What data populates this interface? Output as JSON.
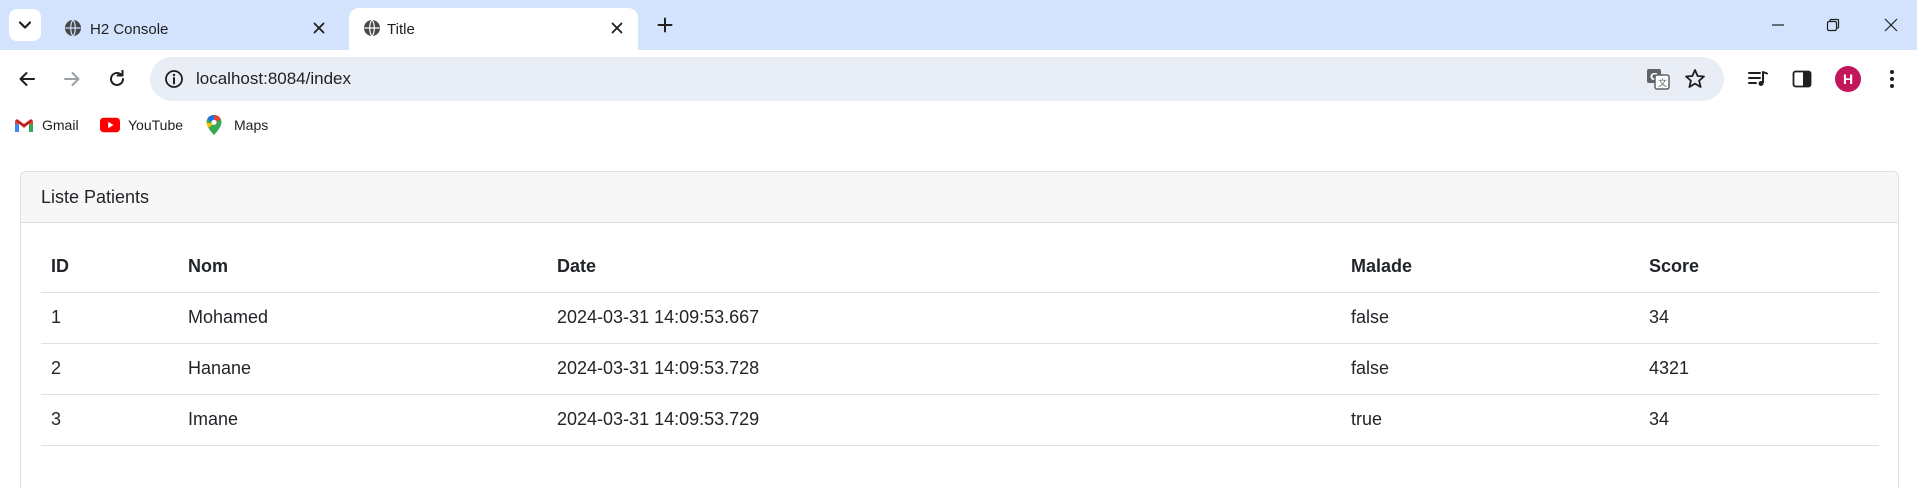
{
  "browser": {
    "tabs": [
      {
        "title": "H2 Console",
        "active": false
      },
      {
        "title": "Title",
        "active": true
      }
    ],
    "url": "localhost:8084/index",
    "profile_initial": "H",
    "bookmarks": [
      {
        "label": "Gmail",
        "icon": "gmail-icon"
      },
      {
        "label": "YouTube",
        "icon": "youtube-icon"
      },
      {
        "label": "Maps",
        "icon": "maps-icon"
      }
    ],
    "colors": {
      "tabstrip": "#d3e3fd",
      "omnibox": "#e9eef6",
      "avatar": "#c2185b"
    }
  },
  "page": {
    "card_title": "Liste Patients",
    "table": {
      "headers": [
        "ID",
        "Nom",
        "Date",
        "Malade",
        "Score"
      ],
      "rows": [
        [
          "1",
          "Mohamed",
          "2024-03-31 14:09:53.667",
          "false",
          "34"
        ],
        [
          "2",
          "Hanane",
          "2024-03-31 14:09:53.728",
          "false",
          "4321"
        ],
        [
          "3",
          "Imane",
          "2024-03-31 14:09:53.729",
          "true",
          "34"
        ]
      ]
    }
  }
}
